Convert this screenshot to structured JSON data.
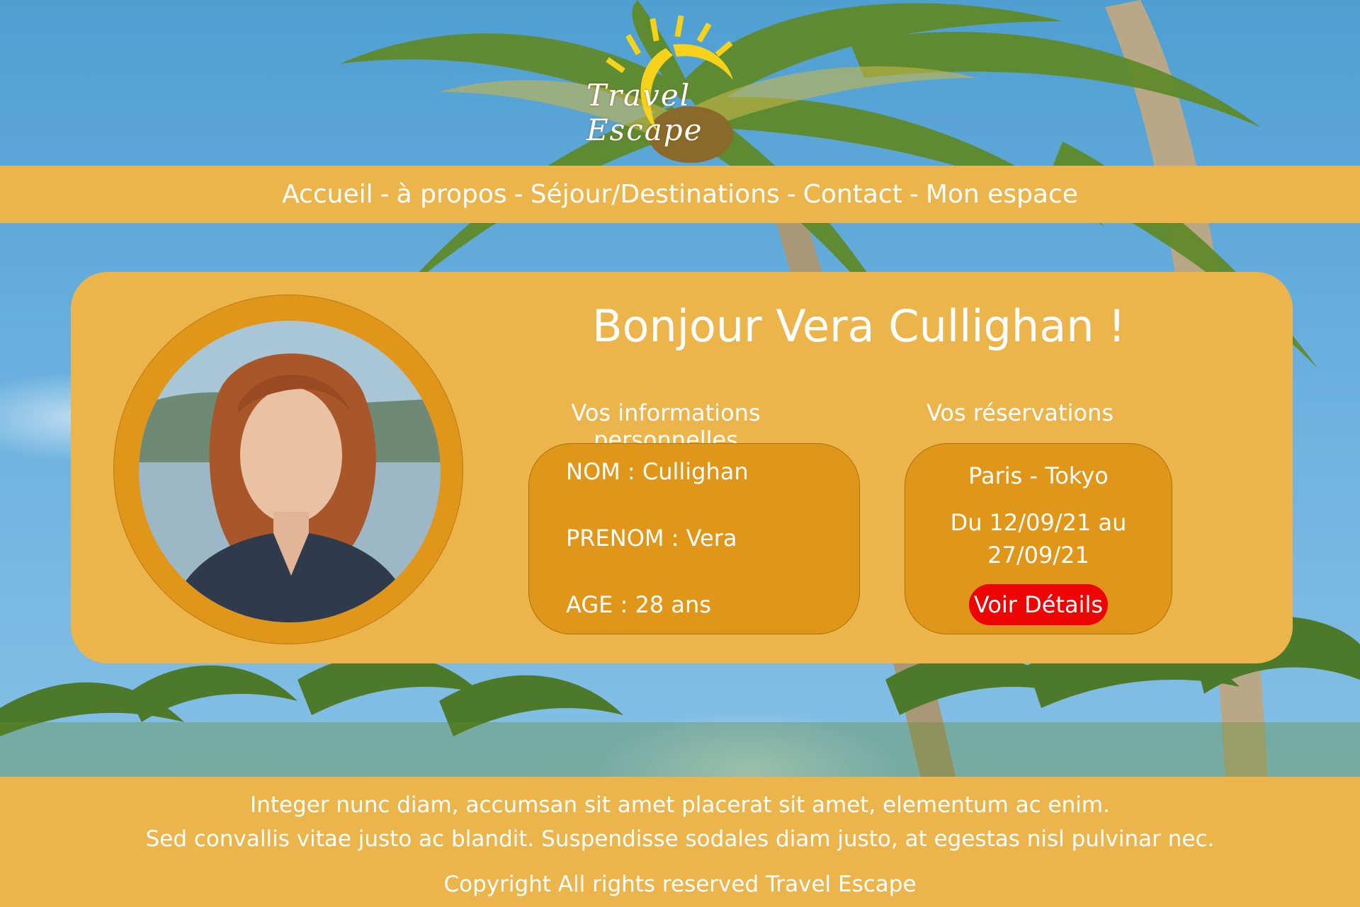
{
  "brand": {
    "name": "Travel Escape",
    "logo_icon": "sun-icon"
  },
  "nav": {
    "items": [
      {
        "label": "Accueil"
      },
      {
        "label": "à propos"
      },
      {
        "label": "Séjour/Destinations"
      },
      {
        "label": "Contact"
      },
      {
        "label": "Mon espace"
      }
    ],
    "separator": "-"
  },
  "profile": {
    "greeting": "Bonjour Vera Cullighan !",
    "avatar": "profile-photo",
    "personal_title": "Vos informations personnelles",
    "nom": "NOM : Cullighan",
    "prenom": "PRENOM : Vera",
    "age": "AGE : 28 ans",
    "reservations_title": "Vos réservations",
    "reservation": {
      "route": "Paris - Tokyo",
      "dates": "Du 12/09/21 au 27/09/21",
      "button_label": "Voir Détails"
    }
  },
  "footer": {
    "line1": "Integer nunc diam, accumsan sit amet placerat sit amet, elementum ac enim.",
    "line2": "Sed convallis vitae justo ac blandit. Suspendisse sodales diam justo, at egestas nisl pulvinar nec.",
    "copyright": "Copyright All rights reserved Travel Escape"
  },
  "colors": {
    "band": "#ecb54c",
    "box": "#e09618",
    "button": "#ef0404",
    "text": "#ffffff"
  }
}
